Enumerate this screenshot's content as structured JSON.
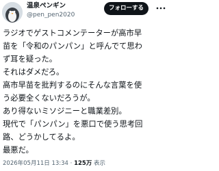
{
  "author": {
    "display_name": "温泉ペンギン",
    "handle": "@pen_pen2020",
    "avatar_icon": "penguin-avatar-icon"
  },
  "follow_button": {
    "label": "フォローする"
  },
  "more_icon": "more-dots-icon",
  "tweet": {
    "lines": [
      "ラジオでゲストコメンテーターが高市早",
      "苗を「令和のパンパン」と呼んでて思わ",
      "ず耳を疑った。",
      "それはダメだろ。",
      "高市早苗を批判するのにそんな言葉を使",
      "う必要全くないだろうが。",
      "あり得ないミソジニーと職業差別。",
      "現代で「パンパン」を悪口で使う思考回",
      "路、どうかしてるよ。",
      "最悪だ。"
    ]
  },
  "meta": {
    "timestamp": "2026年05月11日 13:34",
    "separator": "·",
    "views_count": "125万",
    "views_label": "表示"
  },
  "colors": {
    "text": "#0f1419",
    "secondary": "#536471",
    "button_bg": "#0f1419",
    "button_text": "#ffffff"
  }
}
